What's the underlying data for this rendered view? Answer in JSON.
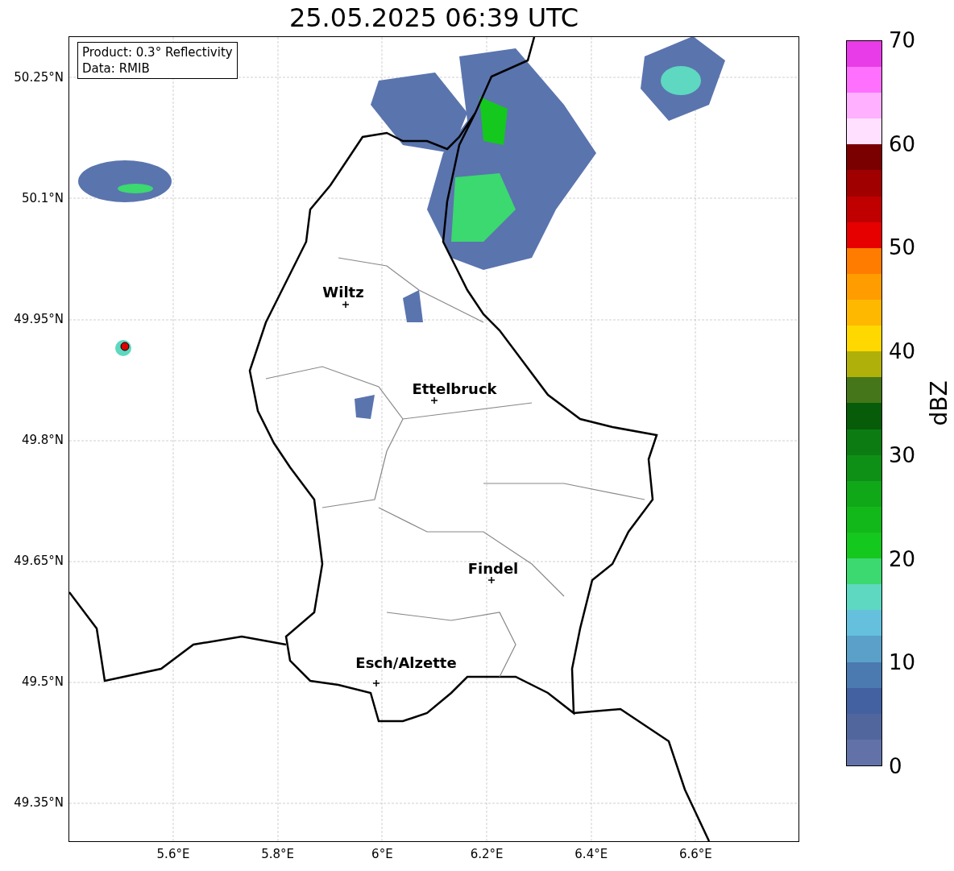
{
  "title": "25.05.2025 06:39 UTC",
  "info_box": [
    "Product: 0.3° Reflectivity",
    "Data: RMIB"
  ],
  "map": {
    "y_ticks": [
      "50.25°N",
      "50.1°N",
      "49.95°N",
      "49.8°N",
      "49.65°N",
      "49.5°N",
      "49.35°N"
    ],
    "x_ticks": [
      "5.6°E",
      "5.8°E",
      "6°E",
      "6.2°E",
      "6.4°E",
      "6.6°E"
    ],
    "places": [
      {
        "name": "Wiltz"
      },
      {
        "name": "Ettelbruck"
      },
      {
        "name": "Findel"
      },
      {
        "name": "Esch/Alzette"
      }
    ]
  },
  "colorbar": {
    "label": "dBZ",
    "ticks": [
      "70",
      "60",
      "50",
      "40",
      "30",
      "20",
      "10",
      "0"
    ],
    "bands": [
      {
        "color": "#6272a8"
      },
      {
        "color": "#52669e"
      },
      {
        "color": "#4360a0"
      },
      {
        "color": "#4a7ab0"
      },
      {
        "color": "#5aa0c8"
      },
      {
        "color": "#64c0dc"
      },
      {
        "color": "#5ed8c0"
      },
      {
        "color": "#3cd870"
      },
      {
        "color": "#14c81e"
      },
      {
        "color": "#12b81a"
      },
      {
        "color": "#10a818"
      },
      {
        "color": "#0e9016"
      },
      {
        "color": "#0c7c12"
      },
      {
        "color": "#065c08"
      },
      {
        "color": "#46761a"
      },
      {
        "color": "#b0b00a"
      },
      {
        "color": "#ffd800"
      },
      {
        "color": "#ffb800"
      },
      {
        "color": "#ff9c00"
      },
      {
        "color": "#ff7c00"
      },
      {
        "color": "#e60000"
      },
      {
        "color": "#c00000"
      },
      {
        "color": "#a00000"
      },
      {
        "color": "#7a0000"
      },
      {
        "color": "#ffe0ff"
      },
      {
        "color": "#ffb0ff"
      },
      {
        "color": "#ff70ff"
      },
      {
        "color": "#e83ce8"
      }
    ]
  }
}
